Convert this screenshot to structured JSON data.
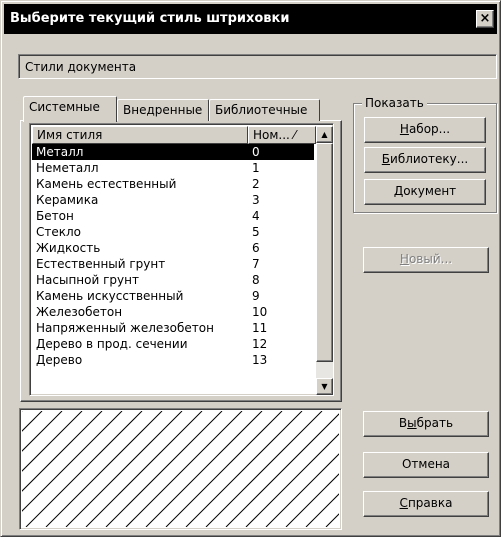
{
  "window": {
    "title": "Выберите текущий стиль штриховки",
    "close_glyph": "×"
  },
  "source": {
    "value": "Стили документа"
  },
  "tabs": [
    {
      "label": "Системные",
      "active": true
    },
    {
      "label": "Внедренные",
      "active": false
    },
    {
      "label": "Библиотечные",
      "active": false
    }
  ],
  "list": {
    "columns": [
      "Имя стиля",
      "Ном... ⁄"
    ],
    "rows": [
      {
        "name": "Металл",
        "num": "0",
        "selected": true
      },
      {
        "name": "Неметалл",
        "num": "1"
      },
      {
        "name": "Камень естественный",
        "num": "2"
      },
      {
        "name": "Керамика",
        "num": "3"
      },
      {
        "name": "Бетон",
        "num": "4"
      },
      {
        "name": "Стекло",
        "num": "5"
      },
      {
        "name": "Жидкость",
        "num": "6"
      },
      {
        "name": "Естественный грунт",
        "num": "7"
      },
      {
        "name": "Насыпной грунт",
        "num": "8"
      },
      {
        "name": "Камень искусственный",
        "num": "9"
      },
      {
        "name": "Железобетон",
        "num": "10"
      },
      {
        "name": "Напряженный железобетон",
        "num": "11"
      },
      {
        "name": "Дерево в прод. сечении",
        "num": "12"
      },
      {
        "name": "Дерево",
        "num": "13"
      }
    ]
  },
  "show_group": {
    "legend": "Показать",
    "buttons": [
      {
        "label": "Набор...",
        "mnemonic": "Н",
        "rest": "абор..."
      },
      {
        "label": "Библиотеку...",
        "mnemonic": "Б",
        "rest": "иблиотеку..."
      },
      {
        "label": "Документ",
        "mnemonic": "Д",
        "rest": "окумент"
      }
    ]
  },
  "new_button": {
    "label": "Новый...",
    "mnemonic": "Н",
    "rest": "овый...",
    "enabled": false
  },
  "action_buttons": {
    "select": {
      "label": "Выбрать",
      "pre": "В",
      "mnemonic": "ы",
      "rest": "брать"
    },
    "cancel": {
      "label": "Отмена"
    },
    "help": {
      "label": "Справка",
      "mnemonic": "С",
      "rest": "правка"
    }
  },
  "preview": {
    "pattern": "diagonal-hatch",
    "stroke_color": "#000000",
    "background": "#ffffff"
  }
}
